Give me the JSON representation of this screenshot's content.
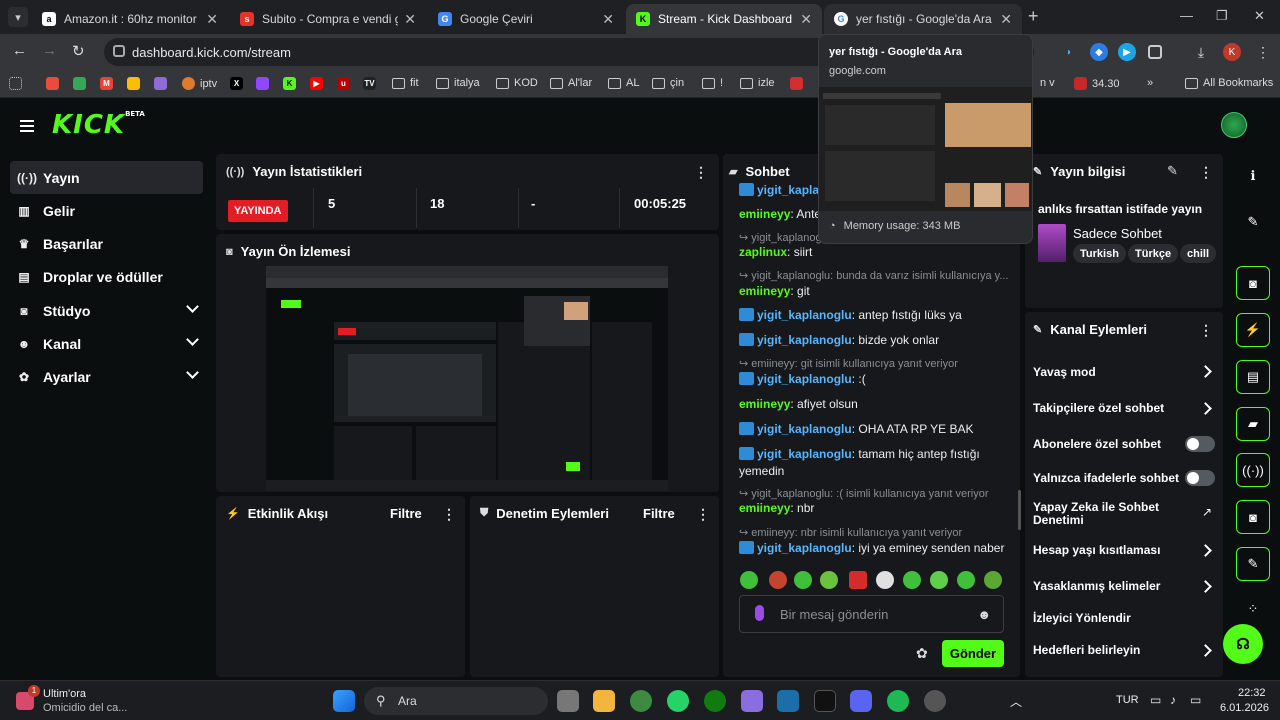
{
  "browser": {
    "tabs": [
      {
        "title": "Amazon.it : 60hz monitor",
        "favicon": "amazon-icon"
      },
      {
        "title": "Subito - Compra e vendi gratis",
        "favicon": "subito-icon"
      },
      {
        "title": "Google Çeviri",
        "favicon": "translate-icon"
      },
      {
        "title": "Stream - Kick Dashboard",
        "favicon": "kick-icon"
      },
      {
        "title": "yer fıstığı - Google'da Ara",
        "favicon": "google-icon"
      }
    ],
    "url": "dashboard.kick.com/stream",
    "bookmarks": [
      "iptv",
      "fit",
      "italya",
      "KOD",
      "Al'lar",
      "AL",
      "çin",
      "!",
      "izle",
      "n v",
      "34.30",
      "All Bookmarks"
    ],
    "hover_card": {
      "title": "yer fıstığı - Google'da Ara",
      "domain": "google.com",
      "memory": "Memory usage: 343 MB"
    }
  },
  "kick": {
    "logo": "KICK",
    "logo_badge": "BETA",
    "sidebar": [
      {
        "label": "Yayın",
        "icon": "broadcast-icon"
      },
      {
        "label": "Gelir",
        "icon": "chart-icon"
      },
      {
        "label": "Başarılar",
        "icon": "trophy-icon"
      },
      {
        "label": "Droplar ve ödüller",
        "icon": "gift-icon"
      },
      {
        "label": "Stüdyo",
        "icon": "studio-icon"
      },
      {
        "label": "Kanal",
        "icon": "person-icon"
      },
      {
        "label": "Ayarlar",
        "icon": "gear-icon"
      }
    ],
    "stats": {
      "title": "Yayın İstatistikleri",
      "status": "YAYINDA",
      "viewers": "5",
      "followers": "18",
      "subs": "-",
      "duration": "00:05:25"
    },
    "preview_title": "Yayın Ön İzlemesi",
    "activity": {
      "title": "Etkinlik Akışı",
      "filter": "Filtre"
    },
    "moderation": {
      "title": "Denetim Eylemleri",
      "filter": "Filtre"
    },
    "chat": {
      "title": "Sohbet",
      "placeholder": "Bir mesaj gönderin",
      "send": "Gönder",
      "messages": [
        {
          "user": "yigit_kaplanoglu",
          "text": ""
        },
        {
          "user": "emiineyy",
          "text": "Antep"
        },
        {
          "reply": "yigit_kaplanoglu: Ant"
        },
        {
          "user": "zaplinux",
          "text": "siirt"
        },
        {
          "reply": "yigit_kaplanoglu: bunda da varız isimli kullanıcıya y..."
        },
        {
          "user": "emiineyy",
          "text": "git"
        },
        {
          "user": "yigit_kaplanoglu",
          "text": "antep fıstığı lüks ya"
        },
        {
          "user": "yigit_kaplanoglu",
          "text": "bizde yok onlar"
        },
        {
          "reply": "emiineyy: git isimli kullanıcıya yanıt veriyor"
        },
        {
          "user": "yigit_kaplanoglu",
          "text": ":("
        },
        {
          "user": "emiineyy",
          "text": "afiyet olsun"
        },
        {
          "user": "yigit_kaplanoglu",
          "text": "OHA ATA RP YE BAK"
        },
        {
          "user": "yigit_kaplanoglu",
          "text": "tamam hiç antep fıstığı yemedin"
        },
        {
          "reply": "yigit_kaplanoglu: :( isimli kullanıcıya yanıt veriyor"
        },
        {
          "user": "emiineyy",
          "text": "nbr"
        },
        {
          "reply": "emiineyy: nbr isimli kullanıcıya yanıt veriyor"
        },
        {
          "user": "yigit_kaplanoglu",
          "text": "iyi ya eminey senden naber"
        }
      ]
    },
    "stream_info": {
      "title": "Yayın bilgisi",
      "stream_title": "anlıks fırsattan istifade yayın",
      "category": "Sadece Sohbet",
      "tags": [
        "Turkish",
        "Türkçe",
        "chill"
      ]
    },
    "channel_actions": {
      "title": "Kanal Eylemleri",
      "items": [
        {
          "label": "Yavaş mod",
          "control": "arrow"
        },
        {
          "label": "Takipçilere özel sohbet",
          "control": "arrow"
        },
        {
          "label": "Abonelere özel sohbet",
          "control": "toggle",
          "on": false
        },
        {
          "label": "Yalnızca ifadelerle sohbet",
          "control": "toggle",
          "on": false
        },
        {
          "label": "Yapay Zeka ile Sohbet Denetimi",
          "control": "external"
        },
        {
          "label": "Hesap yaşı kısıtlaması",
          "control": "arrow"
        },
        {
          "label": "Yasaklanmış kelimeler",
          "control": "arrow"
        },
        {
          "label": "İzleyici Yönlendir",
          "control": "none"
        },
        {
          "label": "Hedefleri belirleyin",
          "control": "arrow"
        }
      ]
    }
  },
  "taskbar": {
    "notif_title": "Ultim'ora",
    "notif_sub": "Omicidio del ca...",
    "search": "Ara",
    "lang": "TUR",
    "time": "22:32",
    "date": "6.01.2026"
  },
  "colors": {
    "kick_green": "#53fc18",
    "live_red": "#e41c24",
    "panel_bg": "#16181b"
  }
}
